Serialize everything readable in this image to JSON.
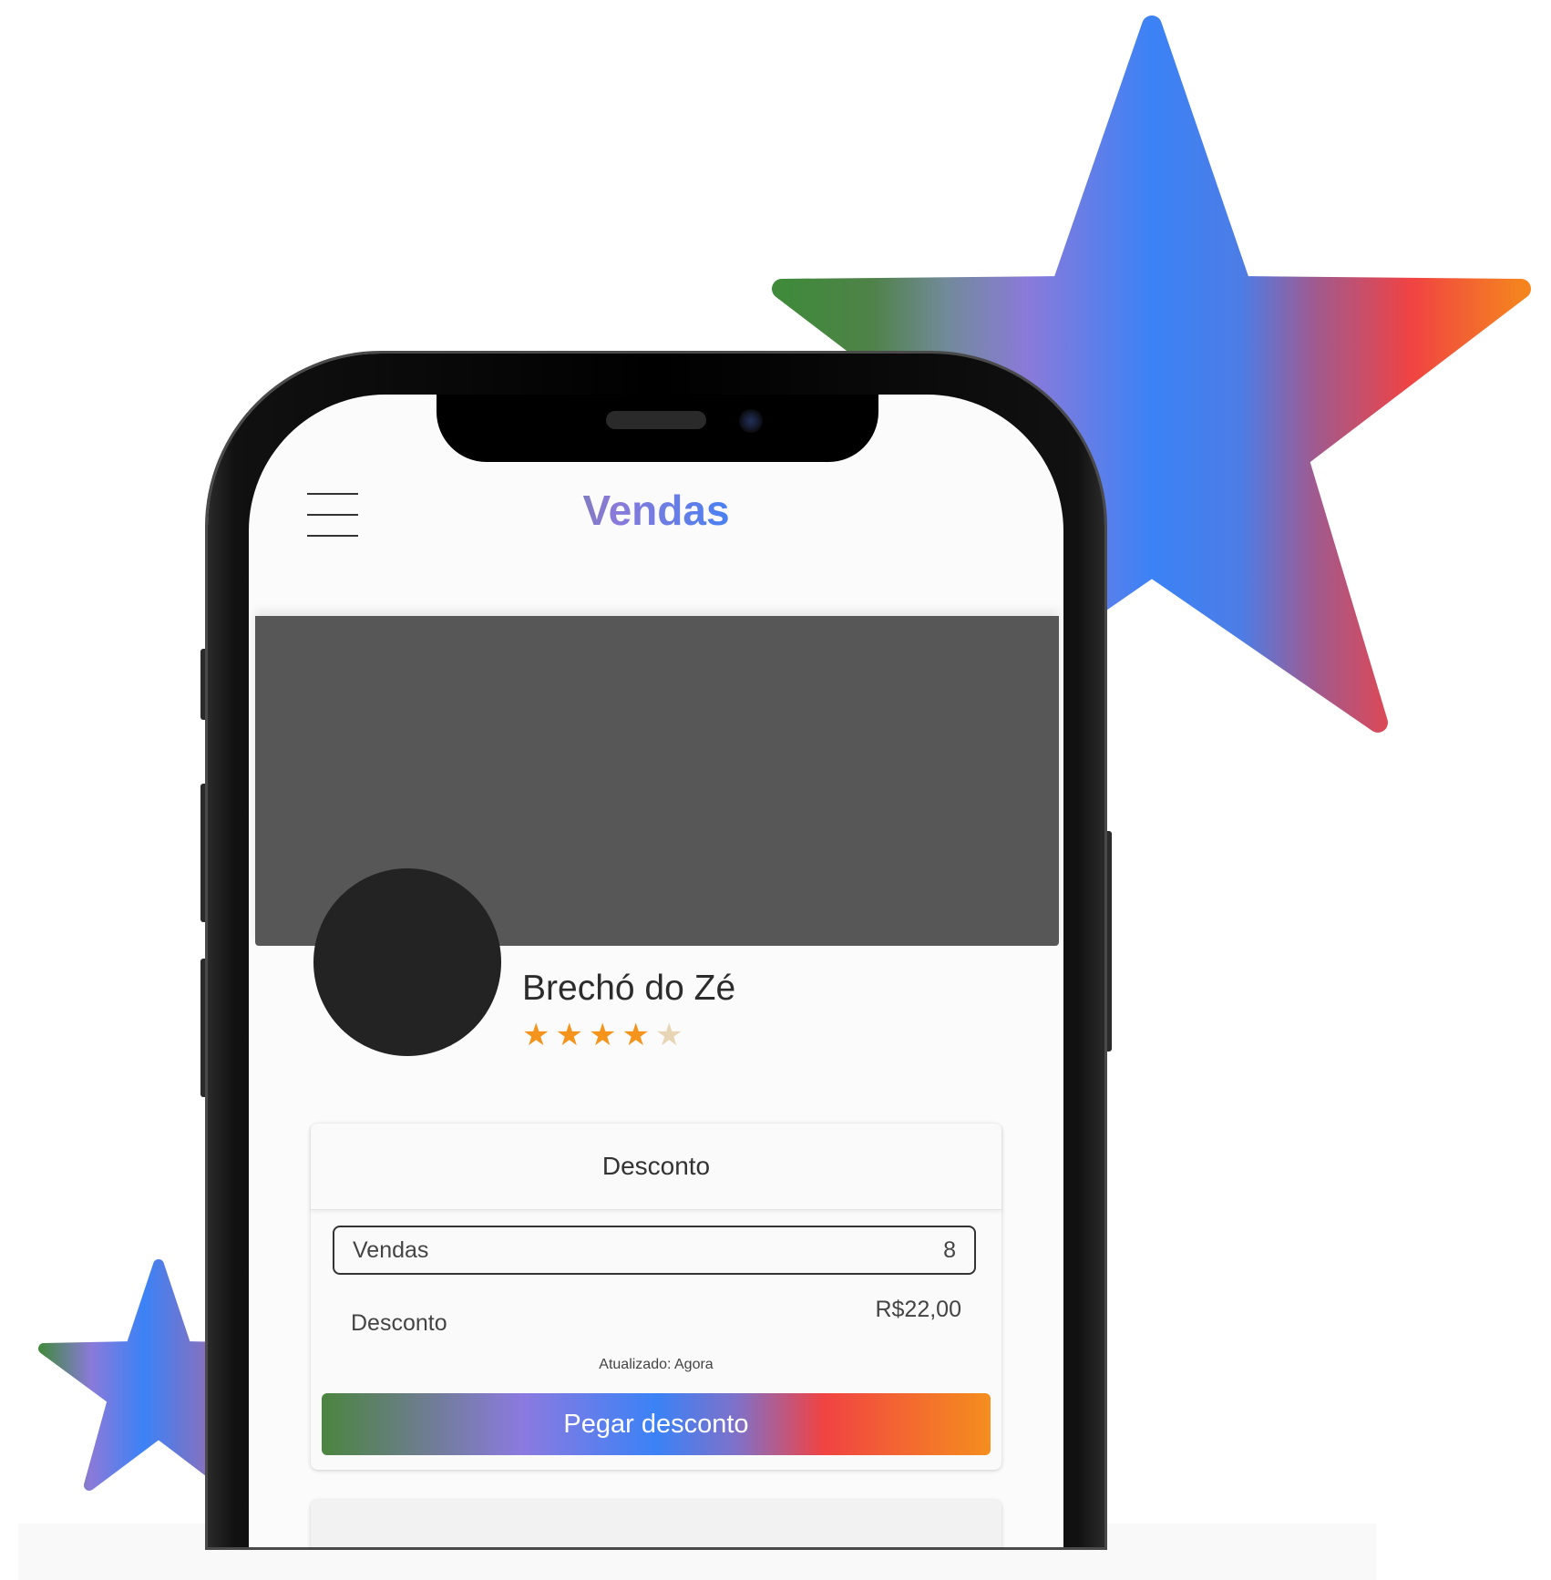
{
  "header": {
    "app_title": "Vendas"
  },
  "store": {
    "name": "Brechó do Zé",
    "rating": 4,
    "rating_max": 5
  },
  "discount_card": {
    "title": "Desconto",
    "sales_label": "Vendas",
    "sales_value": "8",
    "discount_label": "Desconto",
    "discount_value": "R$22,00",
    "updated_text": "Atualizado: Agora",
    "button_label": "Pegar desconto"
  },
  "colors": {
    "rating_filled": "#f5941d",
    "rating_empty": "#e8d5b6",
    "avatar": "#232323",
    "cover": "#575757"
  },
  "icons": [
    "hamburger-menu-icon",
    "star-icon"
  ]
}
